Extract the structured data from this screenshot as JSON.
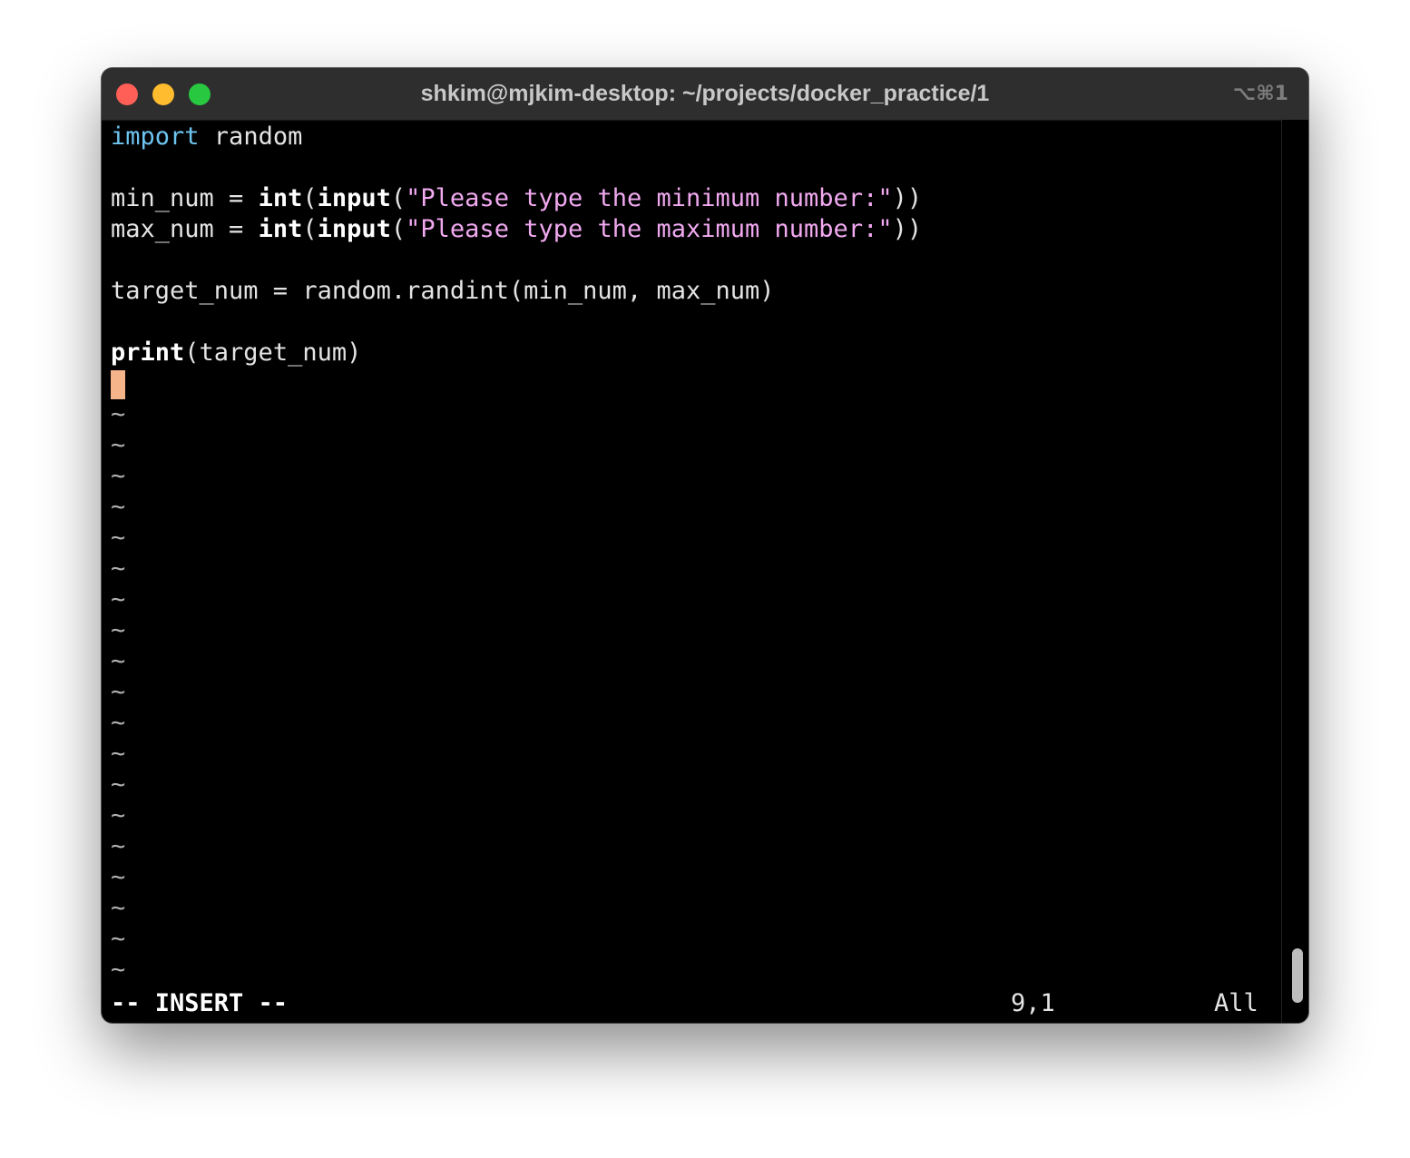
{
  "window": {
    "title": "shkim@mjkim-desktop: ~/projects/docker_practice/1",
    "shortcut": "⌥⌘1"
  },
  "code": {
    "line1": {
      "kw": "import",
      "rest": " random"
    },
    "line3": {
      "pre": "min_num = ",
      "fn1": "int",
      "p1": "(",
      "fn2": "input",
      "p2": "(",
      "str": "\"Please type the minimum number:\"",
      "post": "))"
    },
    "line4": {
      "pre": "max_num = ",
      "fn1": "int",
      "p1": "(",
      "fn2": "input",
      "p2": "(",
      "str": "\"Please type the maximum number:\"",
      "post": "))"
    },
    "line6": {
      "text": "target_num = random.randint(min_num, max_num)"
    },
    "line8": {
      "fn": "print",
      "rest": "(target_num)"
    }
  },
  "tilde": "~",
  "status": {
    "mode": "-- INSERT --",
    "position": "9,1",
    "scroll": "All"
  },
  "colors": {
    "keyword": "#6ec4f0",
    "string": "#f1a9f0",
    "cursor": "#f5b489",
    "background": "#000000"
  }
}
